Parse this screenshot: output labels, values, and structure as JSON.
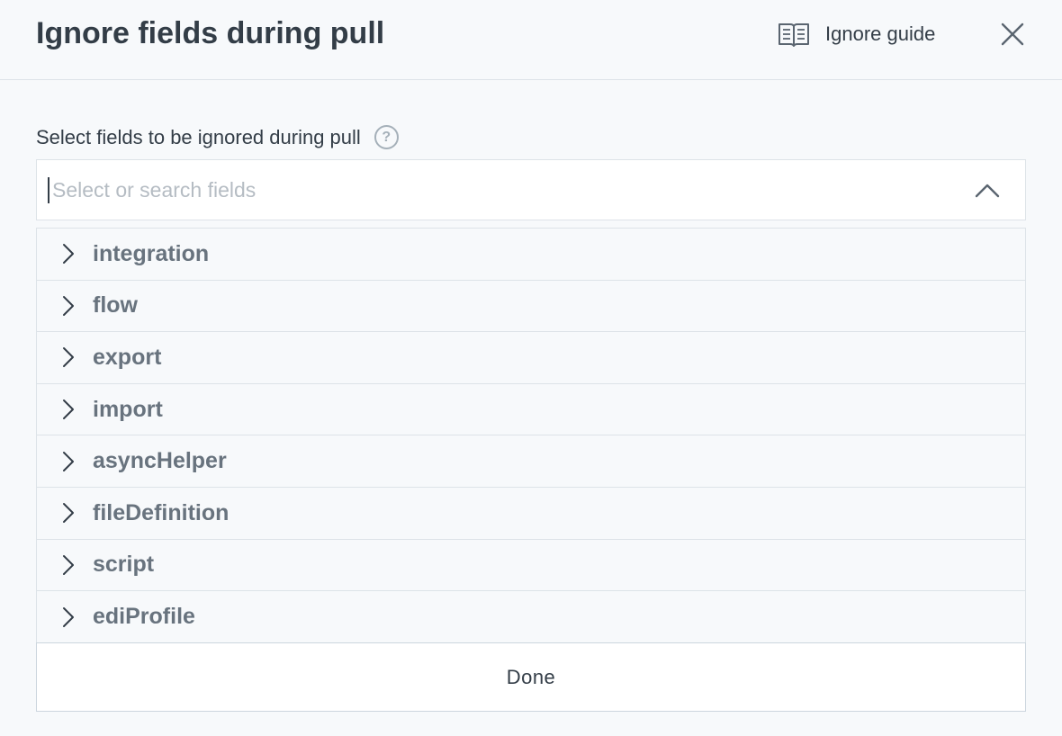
{
  "dialog": {
    "title": "Ignore fields during pull",
    "guide_label": "Ignore guide",
    "guide_icon": "book-open-icon",
    "close_icon": "close-icon"
  },
  "field": {
    "label": "Select fields to be ignored during pull",
    "help_glyph": "?",
    "placeholder": "Select or search fields",
    "value": "",
    "toggle_icon": "chevron-up-icon"
  },
  "options": [
    {
      "label": "integration",
      "icon": "chevron-right-icon"
    },
    {
      "label": "flow",
      "icon": "chevron-right-icon"
    },
    {
      "label": "export",
      "icon": "chevron-right-icon"
    },
    {
      "label": "import",
      "icon": "chevron-right-icon"
    },
    {
      "label": "asyncHelper",
      "icon": "chevron-right-icon"
    },
    {
      "label": "fileDefinition",
      "icon": "chevron-right-icon"
    },
    {
      "label": "script",
      "icon": "chevron-right-icon"
    },
    {
      "label": "ediProfile",
      "icon": "chevron-right-icon"
    }
  ],
  "footer": {
    "done_label": "Done"
  },
  "colors": {
    "background": "#f7f9fb",
    "text": "#333d47",
    "muted_text": "#68737e",
    "placeholder": "#b5bcc3",
    "border": "#dde3e8"
  }
}
